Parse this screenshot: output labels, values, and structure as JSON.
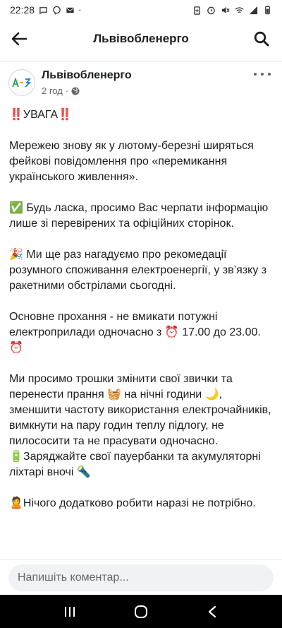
{
  "status_bar": {
    "time": "22:28",
    "left_icons": [
      "chat-icon",
      "viber-icon",
      "mail-icon",
      "dot-icon"
    ],
    "right_icons": [
      "battery-saver-icon",
      "alarm-icon",
      "mute-icon",
      "wifi-icon",
      "signal-icon",
      "battery-icon"
    ]
  },
  "header": {
    "title": "Львівобленерго",
    "back_icon": "arrow-left-icon",
    "search_icon": "search-icon"
  },
  "post": {
    "author": "Львівобленерго",
    "time": "2 год",
    "visibility_icon": "globe-icon",
    "more_icon": "more-icon",
    "lines": {
      "p1": "‼️УВАГА‼️",
      "p2": "Мережею знову як у лютому-березні ширяться фейкові повідомлення про «перемикання українського живлення».",
      "p3": "✅ Будь ласка, просимо Вас черпати інформацію лише зі перевірених та офіційних сторінок.",
      "p4": "🎉 Ми ще раз нагадуємо про рекомедації розумного споживання електроенергії, у зв’язку з ракетними обстрілами сьогодні.",
      "p5": "Основне прохання - не вмикати потужні електроприлади одночасно з ⏰ 17.00 до 23.00. ⏰",
      "p6": "Ми просимо трошки змінити свої звички та перенести прання 🧺 на нічні години 🌙, зменшити частоту використання електрочайників, вимкнути на пару годин теплу підлогу, не пилососити та не прасувати одночасно.",
      "p7": "🔋Заряджайте свої пауербанки та акумуляторні ліхтарі вночі 🔦",
      "p8": "🙎Нічого додатково робити наразі не потрібно."
    }
  },
  "comment": {
    "placeholder": "Напишіть коментар..."
  },
  "nav": {
    "recents_icon": "recents-icon",
    "home_icon": "home-icon",
    "back_icon": "nav-back-icon"
  }
}
